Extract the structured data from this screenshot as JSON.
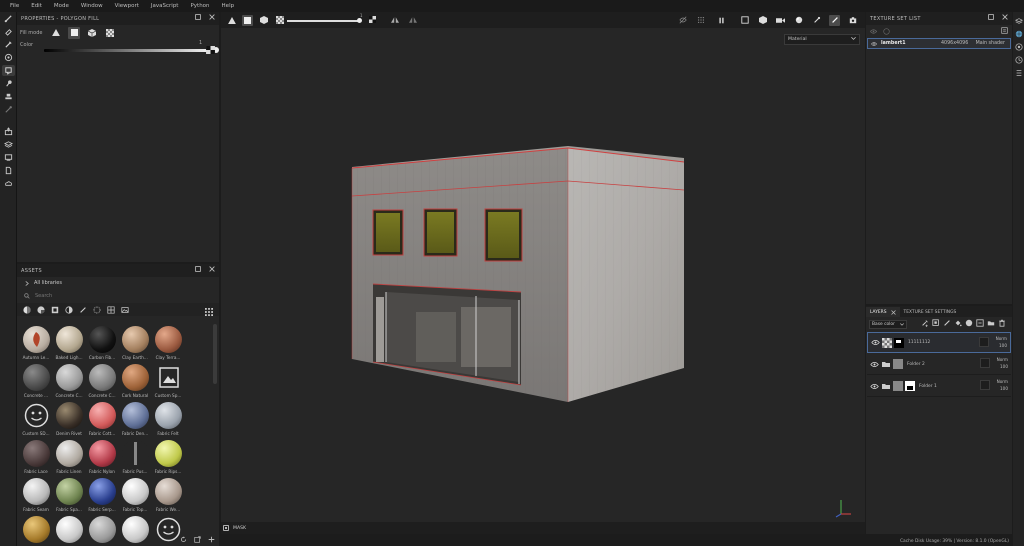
{
  "menu": [
    "File",
    "Edit",
    "Mode",
    "Window",
    "Viewport",
    "JavaScript",
    "Python",
    "Help"
  ],
  "properties": {
    "title": "PROPERTIES - POLYGON FILL",
    "fill_mode_label": "Fill mode",
    "color_label": "Color",
    "color_value": "1"
  },
  "assets": {
    "title": "ASSETS",
    "breadcrumb": "All libraries",
    "search_placeholder": "Search",
    "items": [
      {
        "name": "Autumn Le...",
        "style": "leaf"
      },
      {
        "name": "Baked Ligh...",
        "style": "tan"
      },
      {
        "name": "Carbon Fib...",
        "style": "black"
      },
      {
        "name": "Clay Earth...",
        "style": "clay"
      },
      {
        "name": "Clay Terra...",
        "style": "terracotta"
      },
      {
        "name": "Concrete ...",
        "style": "darkgrey"
      },
      {
        "name": "Concrete C...",
        "style": "grey"
      },
      {
        "name": "Concrete C...",
        "style": "midgrey"
      },
      {
        "name": "Cork Natural",
        "style": "cork"
      },
      {
        "name": "Custom Sp...",
        "style": "custom"
      },
      {
        "name": "Custom SD...",
        "style": "smiley"
      },
      {
        "name": "Denim Rivet",
        "style": "rivet"
      },
      {
        "name": "Fabric Cott...",
        "style": "pink"
      },
      {
        "name": "Fabric Den...",
        "style": "denim"
      },
      {
        "name": "Fabric Felt",
        "style": "felt"
      },
      {
        "name": "Fabric Lace",
        "style": "lace"
      },
      {
        "name": "Fabric Linen",
        "style": "linen"
      },
      {
        "name": "Fabric Nylon",
        "style": "nylon"
      },
      {
        "name": "Fabric Pus...",
        "style": "pushpin"
      },
      {
        "name": "Fabric Rips...",
        "style": "ripstop"
      },
      {
        "name": "Fabric Seam",
        "style": "seam"
      },
      {
        "name": "Fabric Spa...",
        "style": "olive"
      },
      {
        "name": "Fabric Serp...",
        "style": "navy"
      },
      {
        "name": "Fabric Top...",
        "style": "white"
      },
      {
        "name": "Fabric We...",
        "style": "weave"
      },
      {
        "name": "",
        "style": "gold"
      },
      {
        "name": "",
        "style": "white"
      },
      {
        "name": "",
        "style": "grey"
      },
      {
        "name": "",
        "style": "white"
      },
      {
        "name": "",
        "style": "smiley"
      }
    ]
  },
  "viewport": {
    "slider_value": "1",
    "material_dropdown": "Material",
    "mask_label": "MASK"
  },
  "texture_set_list": {
    "title": "TEXTURE SET LIST",
    "items": [
      {
        "name": "lambert1",
        "resolution": "4096x4096",
        "shader": "Main shader"
      }
    ]
  },
  "layers": {
    "tab_layers": "LAYERS",
    "tab_settings": "TEXTURE SET SETTINGS",
    "channel": "Base color",
    "items": [
      {
        "name": "11111112",
        "blend": "Norm",
        "opacity": "100",
        "type": "fill",
        "selected": true
      },
      {
        "name": "Folder 2",
        "blend": "Norm",
        "opacity": "100",
        "type": "folder",
        "selected": false
      },
      {
        "name": "Folder 1",
        "blend": "Norm",
        "opacity": "100",
        "type": "folder",
        "selected": false
      }
    ]
  },
  "status": {
    "text": "Cache Disk Usage:  39% | Version: 8.1.0 (OpenGL)"
  },
  "colors": {
    "accent": "#4a6a9a",
    "bg": "#1c1c1c",
    "panel": "#262626"
  }
}
